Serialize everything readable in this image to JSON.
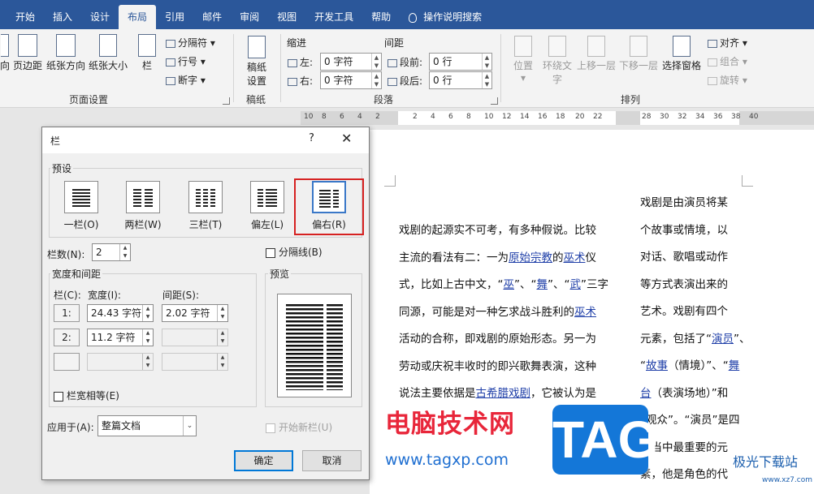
{
  "tabs": [
    "开始",
    "插入",
    "设计",
    "布局",
    "引用",
    "邮件",
    "审阅",
    "视图",
    "开发工具",
    "帮助",
    "操作说明搜索"
  ],
  "active_tab": "布局",
  "ribbon": {
    "page_setup": {
      "label": "页面设置",
      "buttons": [
        "向",
        "页边距",
        "纸张方向",
        "纸张大小",
        "栏"
      ],
      "small": [
        "分隔符",
        "行号",
        "断字"
      ]
    },
    "manuscript": {
      "label": "稿纸",
      "button_line1": "稿纸",
      "button_line2": "设置"
    },
    "paragraph": {
      "label": "段落",
      "indent_title": "缩进",
      "spacing_title": "间距",
      "left": "左:",
      "right": "右:",
      "before": "段前:",
      "after": "段后:",
      "left_val": "0 字符",
      "right_val": "0 字符",
      "before_val": "0 行",
      "after_val": "0 行"
    },
    "arrange": {
      "label": "排列",
      "buttons": [
        "位置",
        "环绕文字",
        "上移一层",
        "下移一层",
        "选择窗格"
      ],
      "small": [
        "对齐",
        "组合",
        "旋转"
      ]
    }
  },
  "ruler": [
    "10",
    "8",
    "6",
    "4",
    "2",
    "2",
    "4",
    "6",
    "8",
    "10",
    "12",
    "14",
    "16",
    "18",
    "20",
    "22",
    "28",
    "30",
    "32",
    "34",
    "36",
    "38",
    "40"
  ],
  "doc": {
    "left_col": [
      [
        {
          "t": "戏剧的起源实不可考，有多种假说。比较"
        }
      ],
      [
        {
          "t": "主流的看法有二：一为"
        },
        {
          "t": "原始宗教",
          "l": 1
        },
        {
          "t": "的"
        },
        {
          "t": "巫术",
          "l": 1
        },
        {
          "t": "仪"
        }
      ],
      [
        {
          "t": "式，比如上古中文，“"
        },
        {
          "t": "巫",
          "l": 1
        },
        {
          "t": "”、“"
        },
        {
          "t": "舞",
          "l": 1
        },
        {
          "t": "”、“"
        },
        {
          "t": "武",
          "l": 1
        },
        {
          "t": "”三字"
        }
      ],
      [
        {
          "t": "同源，可能是对一种乞求战斗胜利的"
        },
        {
          "t": "巫术",
          "l": 1
        }
      ],
      [
        {
          "t": "活动的合称，即戏剧的原始形态。另一为"
        }
      ],
      [
        {
          "t": "劳动或庆祝丰收时的即兴歌舞表演，这种"
        }
      ],
      [
        {
          "t": "说法主要依据是"
        },
        {
          "t": "古希腊戏剧",
          "l": 1
        },
        {
          "t": "，它被认为是"
        }
      ]
    ],
    "right_col": [
      [
        {
          "t": "戏剧是由演员将某"
        }
      ],
      [
        {
          "t": "个故事或情境，以"
        }
      ],
      [
        {
          "t": "对话、歌唱或动作"
        }
      ],
      [
        {
          "t": "等方式表演出来的"
        }
      ],
      [
        {
          "t": "艺术。戏剧有四个"
        }
      ],
      [
        {
          "t": "元素，包括了“"
        },
        {
          "t": "演员",
          "l": 1
        },
        {
          "t": "”、"
        }
      ],
      [
        {
          "t": "“"
        },
        {
          "t": "故事",
          "l": 1
        },
        {
          "t": "（情境）”、“"
        },
        {
          "t": "舞",
          "l": 1
        }
      ],
      [
        {
          "t": "台",
          "l": 1
        },
        {
          "t": "（表演场地）”和"
        }
      ],
      [
        {
          "t": "“观众”。“演员”是四"
        }
      ],
      [
        {
          "t": "者当中最重要的元"
        }
      ],
      [
        {
          "t": "素，他是角色的代"
        }
      ]
    ]
  },
  "dialog": {
    "title": "栏",
    "help": "?",
    "close": "✕",
    "presets_title": "预设",
    "presets": [
      "一栏(O)",
      "两栏(W)",
      "三栏(T)",
      "偏左(L)",
      "偏右(R)"
    ],
    "selected_preset": "偏右(R)",
    "num_cols_label": "栏数(N):",
    "num_cols": "2",
    "separator_label": "分隔线(B)",
    "width_spacing_title": "宽度和间距",
    "col_header": "栏(C):",
    "width_header": "宽度(I):",
    "spacing_header": "间距(S):",
    "rows": [
      {
        "n": "1:",
        "w": "24.43 字符",
        "s": "2.02 字符"
      },
      {
        "n": "2:",
        "w": "11.2 字符",
        "s": ""
      },
      {
        "n": "",
        "w": "",
        "s": ""
      }
    ],
    "equal_label": "栏宽相等(E)",
    "preview_title": "预览",
    "apply_label": "应用于(A):",
    "apply_value": "整篇文档",
    "new_col_label": "开始新栏(U)",
    "ok": "确定",
    "cancel": "取消"
  },
  "watermark": {
    "cn": "电脑技术网",
    "url": "www.tagxp.com",
    "tag": "TAG",
    "jg": "极光下载站",
    "jg_url": "www.xz7.com"
  }
}
